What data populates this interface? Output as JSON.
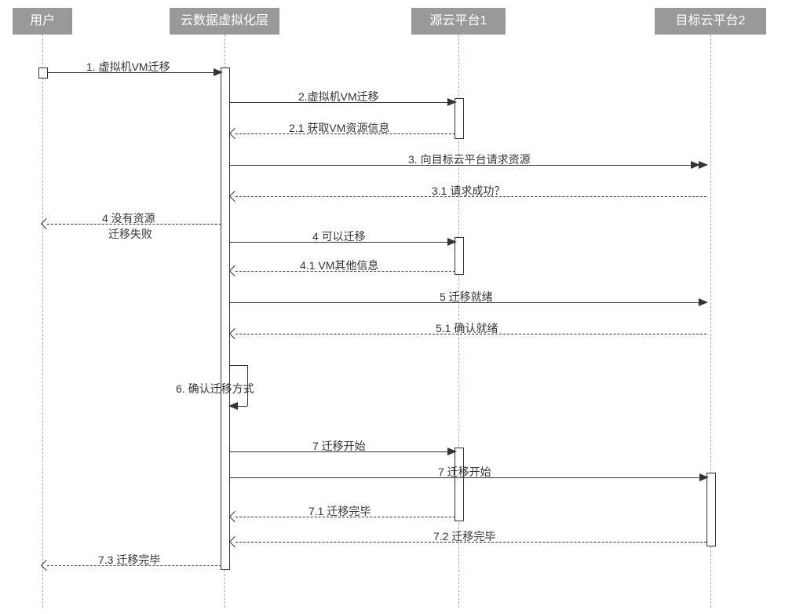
{
  "actors": {
    "user": "用户",
    "virt": "云数据虚拟化层",
    "src": "源云平台1",
    "dst": "目标云平台2"
  },
  "messages": {
    "m1": "1. 虚拟机VM迁移",
    "m2": "2.虚拟机VM迁移",
    "m21": "2.1 获取VM资源信息",
    "m3": "3. 向目标云平台请求资源",
    "m31": "3.1 请求成功？",
    "m4fail1": "4 没有资源",
    "m4fail2": "迁移失败",
    "m4ok": "4 可以迁移",
    "m41": "4.1 VM其他信息",
    "m5": "5 迁移就绪",
    "m51": "5.1 确认就绪",
    "m6": "6. 确认迁移方式",
    "m7a": "7 迁移开始",
    "m7b": "7 迁移开始",
    "m71": "7.1 迁移完毕",
    "m72": "7.2 迁移完毕",
    "m73": "7.3 迁移完毕"
  },
  "chart_data": {
    "type": "sequence_diagram",
    "actors": [
      "用户",
      "云数据虚拟化层",
      "源云平台1",
      "目标云平台2"
    ],
    "messages": [
      {
        "from": "用户",
        "to": "云数据虚拟化层",
        "label": "1. 虚拟机VM迁移",
        "style": "solid"
      },
      {
        "from": "云数据虚拟化层",
        "to": "源云平台1",
        "label": "2.虚拟机VM迁移",
        "style": "solid"
      },
      {
        "from": "源云平台1",
        "to": "云数据虚拟化层",
        "label": "2.1 获取VM资源信息",
        "style": "dashed"
      },
      {
        "from": "云数据虚拟化层",
        "to": "目标云平台2",
        "label": "3. 向目标云平台请求资源",
        "style": "solid_async"
      },
      {
        "from": "目标云平台2",
        "to": "云数据虚拟化层",
        "label": "3.1 请求成功？",
        "style": "dashed"
      },
      {
        "from": "云数据虚拟化层",
        "to": "用户",
        "label": "4 没有资源 迁移失败",
        "style": "dashed"
      },
      {
        "from": "云数据虚拟化层",
        "to": "源云平台1",
        "label": "4 可以迁移",
        "style": "solid"
      },
      {
        "from": "源云平台1",
        "to": "云数据虚拟化层",
        "label": "4.1 VM其他信息",
        "style": "dashed"
      },
      {
        "from": "云数据虚拟化层",
        "to": "目标云平台2",
        "label": "5 迁移就绪",
        "style": "solid"
      },
      {
        "from": "目标云平台2",
        "to": "云数据虚拟化层",
        "label": "5.1 确认就绪",
        "style": "dashed"
      },
      {
        "from": "云数据虚拟化层",
        "to": "云数据虚拟化层",
        "label": "6. 确认迁移方式",
        "style": "self"
      },
      {
        "from": "云数据虚拟化层",
        "to": "源云平台1",
        "label": "7 迁移开始",
        "style": "solid"
      },
      {
        "from": "云数据虚拟化层",
        "to": "目标云平台2",
        "label": "7 迁移开始",
        "style": "solid"
      },
      {
        "from": "源云平台1",
        "to": "云数据虚拟化层",
        "label": "7.1 迁移完毕",
        "style": "dashed"
      },
      {
        "from": "目标云平台2",
        "to": "云数据虚拟化层",
        "label": "7.2 迁移完毕",
        "style": "dashed"
      },
      {
        "from": "云数据虚拟化层",
        "to": "用户",
        "label": "7.3 迁移完毕",
        "style": "dashed"
      }
    ]
  }
}
